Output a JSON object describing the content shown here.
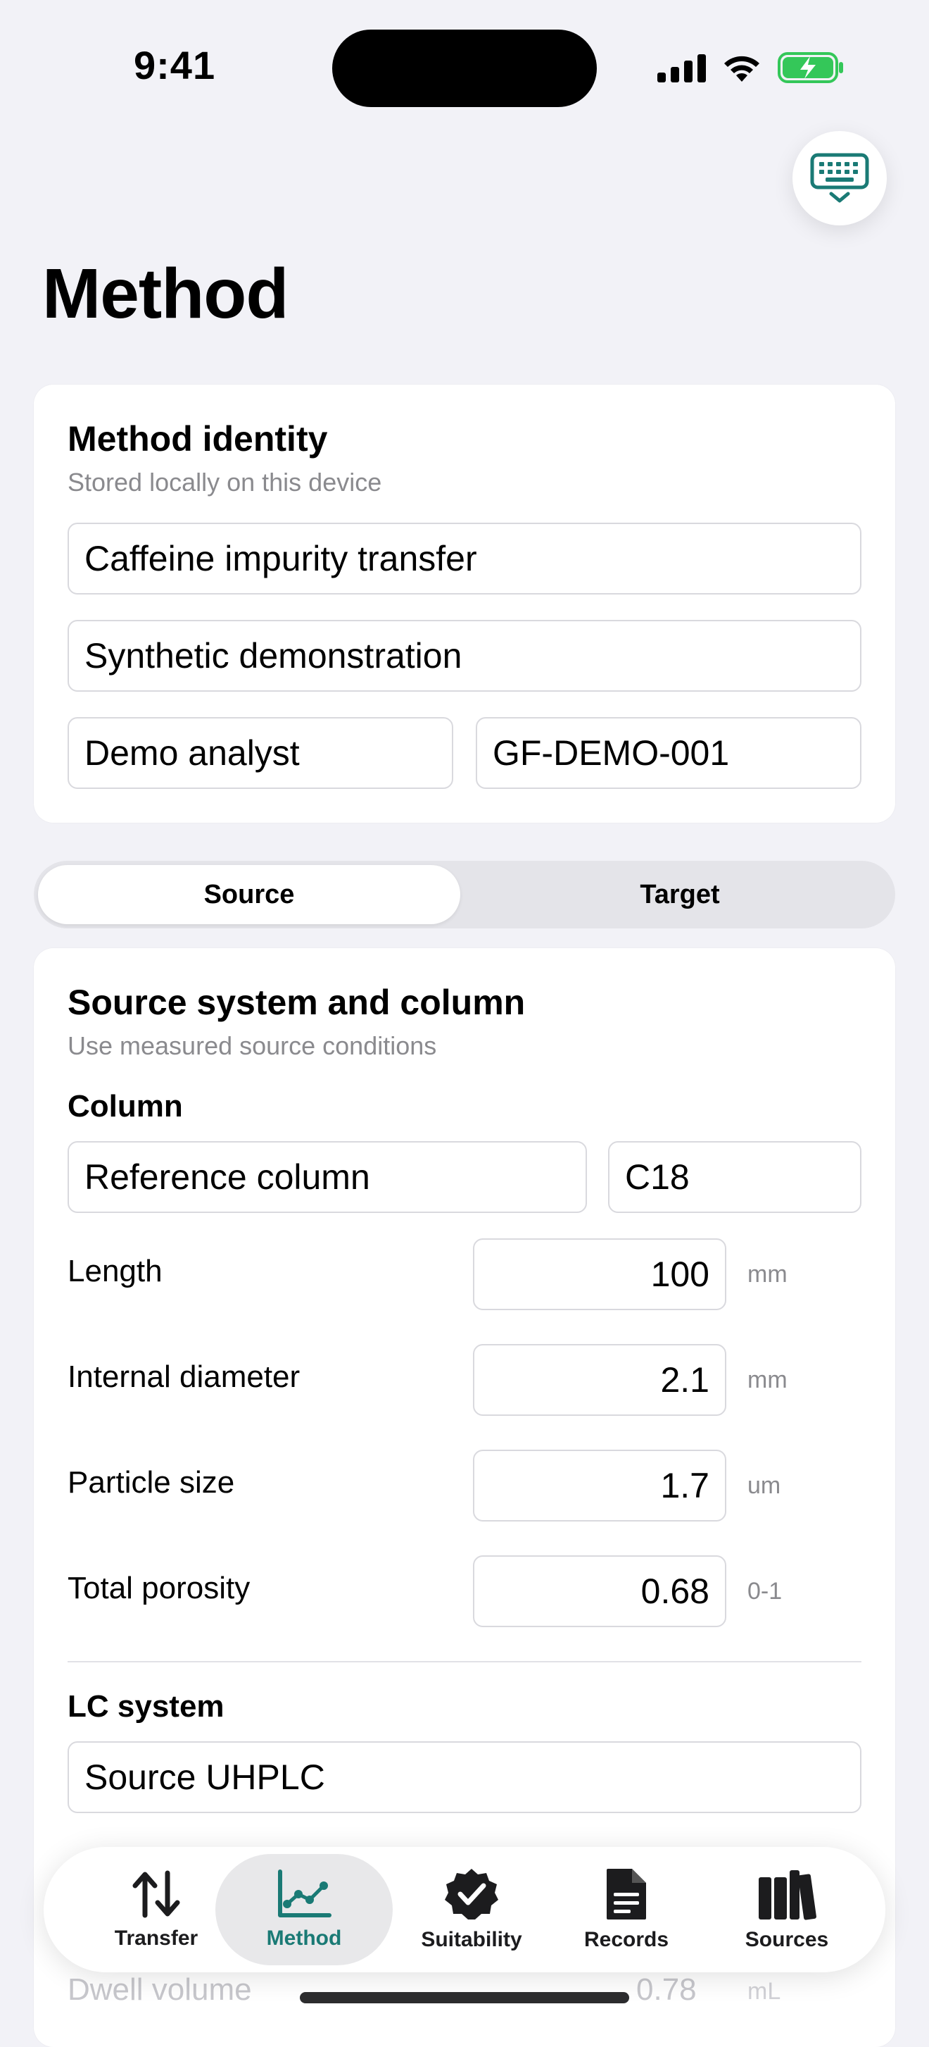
{
  "status_bar": {
    "time": "9:41"
  },
  "page": {
    "title": "Method"
  },
  "identity": {
    "title": "Method identity",
    "subtitle": "Stored locally on this device",
    "method_name": "Caffeine impurity transfer",
    "project": "Synthetic demonstration",
    "analyst": "Demo analyst",
    "method_id": "GF-DEMO-001"
  },
  "segment": {
    "source": "Source",
    "target": "Target",
    "selected": "Source"
  },
  "source_card": {
    "title": "Source system and column",
    "subtitle": "Use measured source conditions",
    "column_heading": "Column",
    "column_name": "Reference column",
    "phase": "C18",
    "rows": [
      {
        "label": "Length",
        "value": "100",
        "unit": "mm"
      },
      {
        "label": "Internal diameter",
        "value": "2.1",
        "unit": "mm"
      },
      {
        "label": "Particle size",
        "value": "1.7",
        "unit": "um"
      },
      {
        "label": "Total porosity",
        "value": "0.68",
        "unit": "0-1"
      }
    ],
    "lc_heading": "LC system",
    "lc_name": "Source UHPLC",
    "partial_row": {
      "label": "Dwell volume",
      "value": "0.78",
      "unit": "mL"
    }
  },
  "tabs": [
    {
      "label": "Transfer",
      "icon": "arrows-up-down-icon"
    },
    {
      "label": "Method",
      "icon": "chart-line-icon"
    },
    {
      "label": "Suitability",
      "icon": "checkmark-seal-icon"
    },
    {
      "label": "Records",
      "icon": "document-icon"
    },
    {
      "label": "Sources",
      "icon": "books-icon"
    }
  ],
  "colors": {
    "accent": "#1a7a75",
    "battery": "#34c759"
  }
}
